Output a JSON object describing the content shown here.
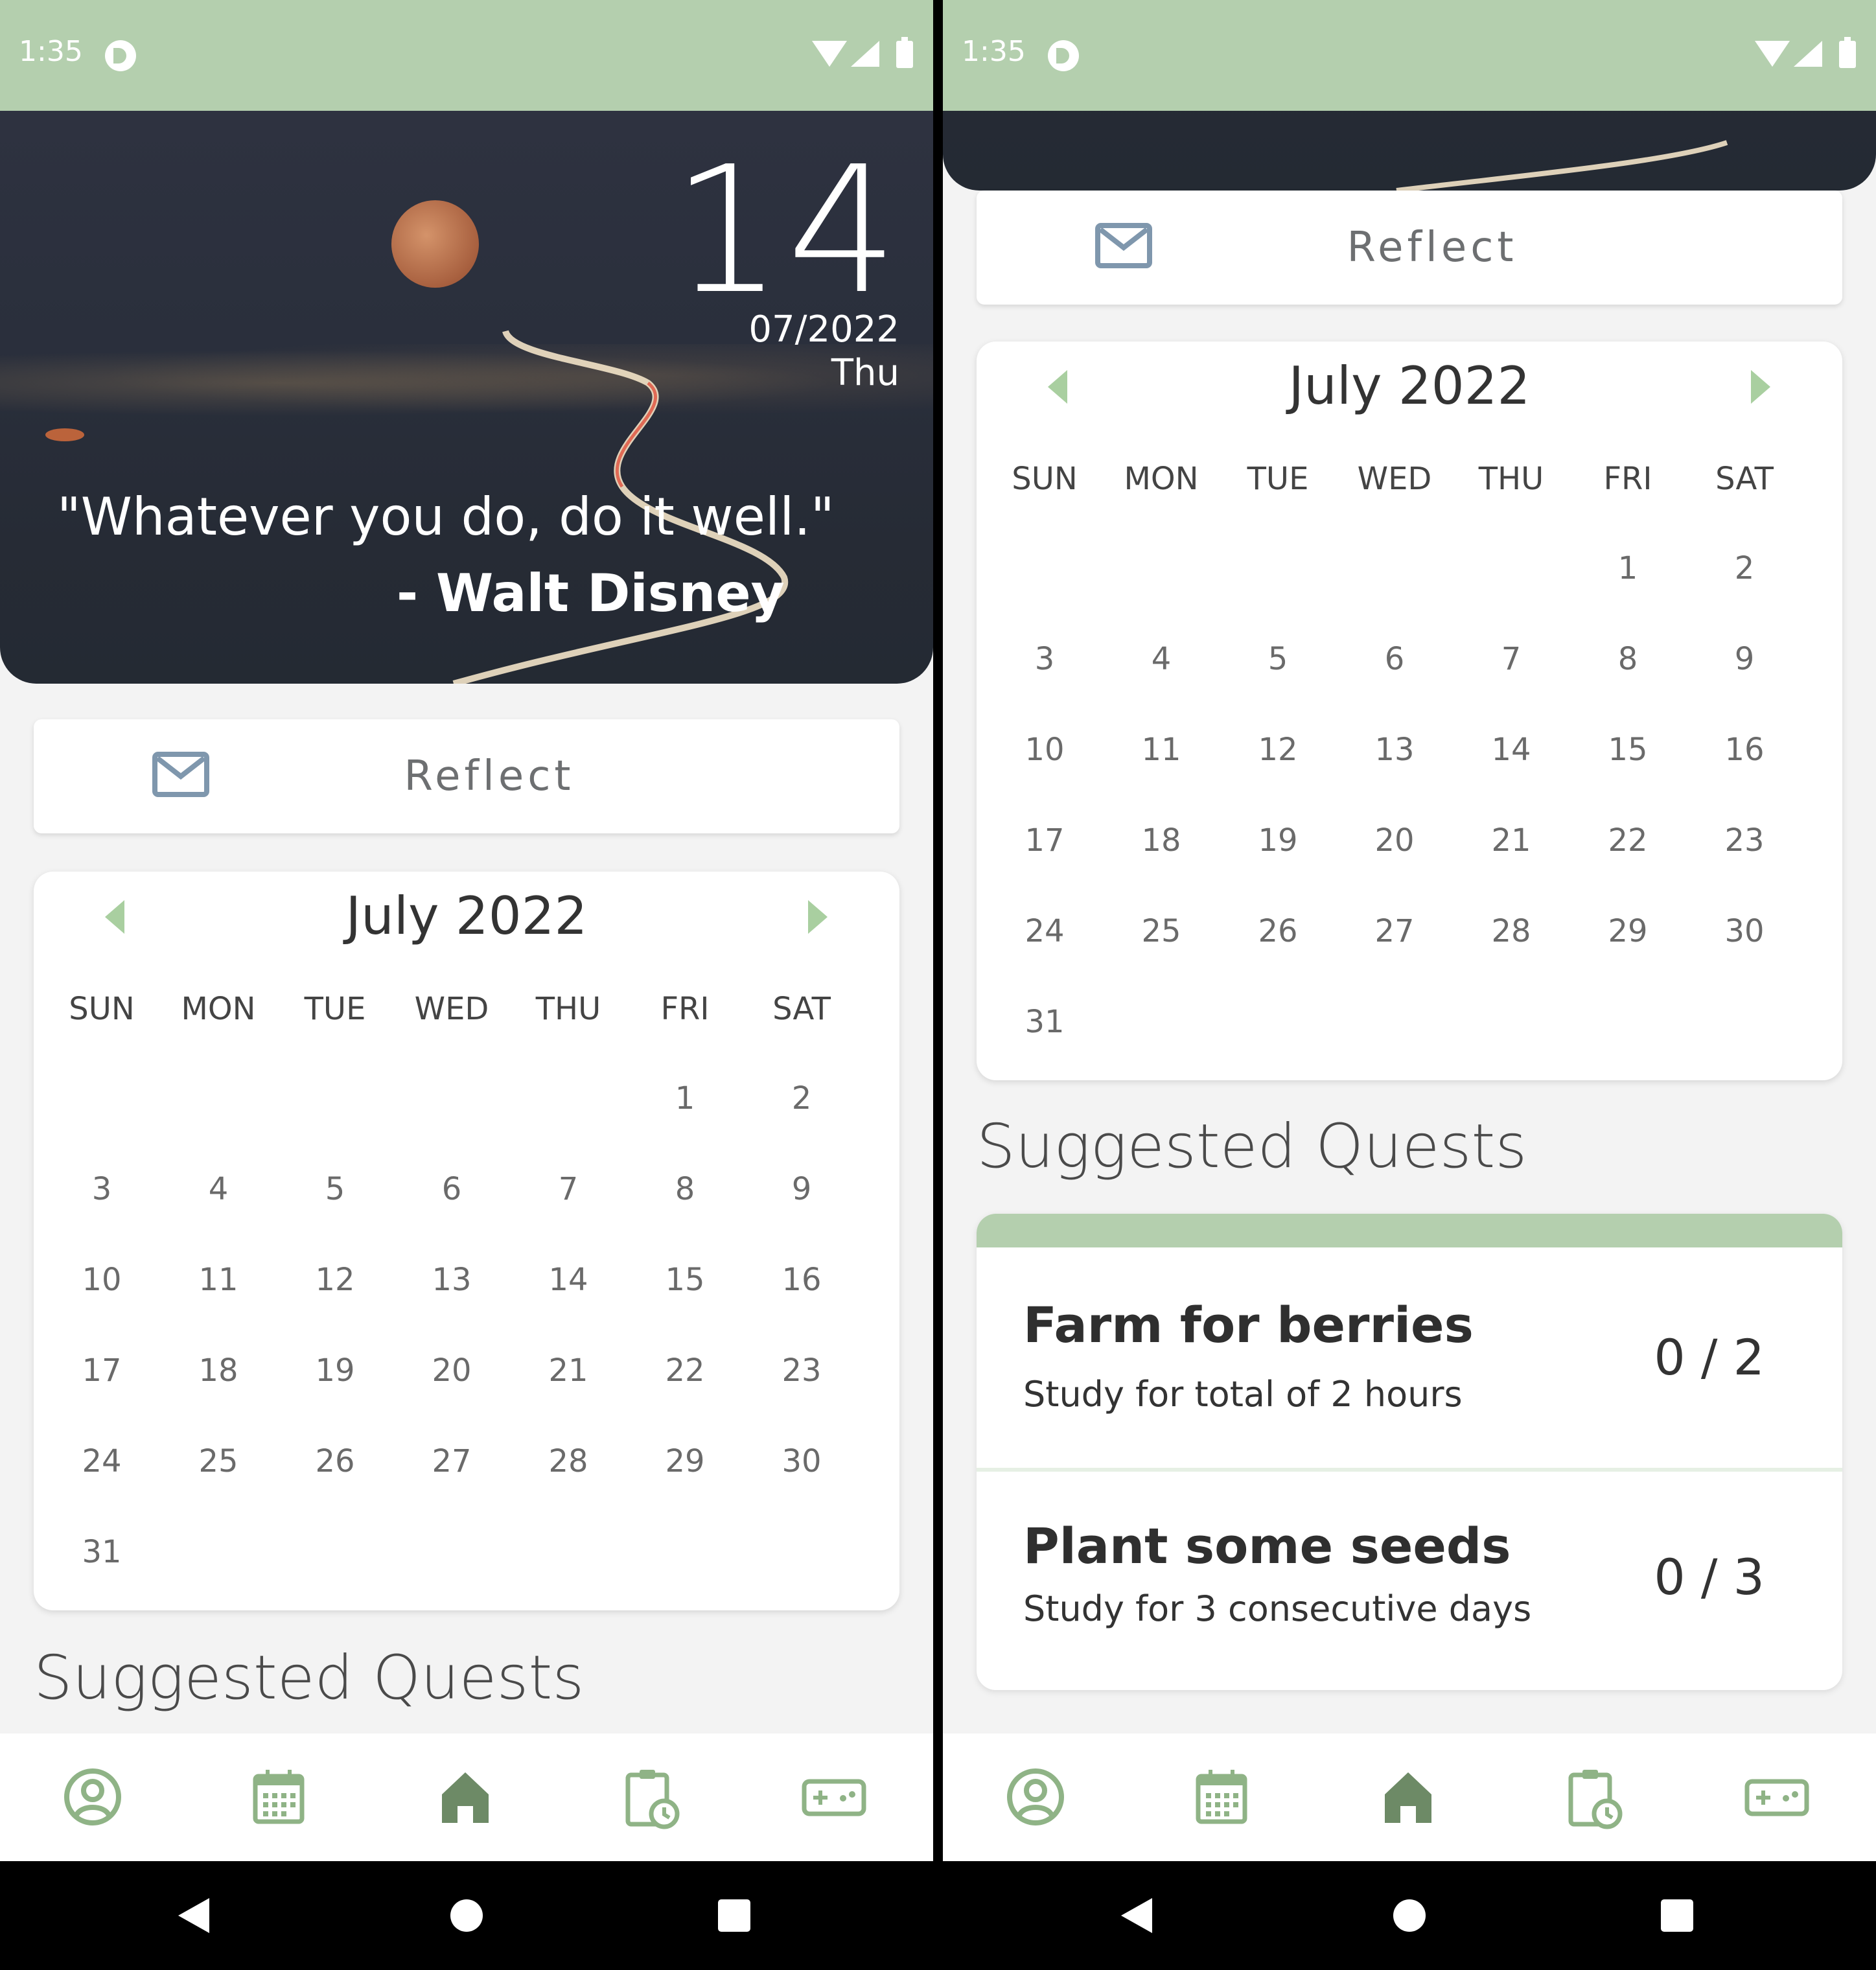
{
  "status_bar": {
    "time": "1:35"
  },
  "hero": {
    "day": "14",
    "month_year": "07/2022",
    "weekday": "Thu",
    "quote": "\"Whatever you do, do it well.\"",
    "author": "- Walt Disney"
  },
  "reflect": {
    "label": "Reflect",
    "icon": "mail-icon"
  },
  "calendar": {
    "title": "July 2022",
    "weekdays": [
      "SUN",
      "MON",
      "TUE",
      "WED",
      "THU",
      "FRI",
      "SAT"
    ],
    "days": [
      "1",
      "2",
      "3",
      "4",
      "5",
      "6",
      "7",
      "8",
      "9",
      "10",
      "11",
      "12",
      "13",
      "14",
      "15",
      "16",
      "17",
      "18",
      "19",
      "20",
      "21",
      "22",
      "23",
      "24",
      "25",
      "26",
      "27",
      "28",
      "29",
      "30",
      "31"
    ]
  },
  "quests": {
    "title": "Suggested Quests",
    "items": [
      {
        "title": "Farm for berries",
        "description": "Study for total of 2 hours",
        "progress": "0 / 2"
      },
      {
        "title": "Plant some seeds",
        "description": "Study for 3 consecutive days",
        "progress": "0 / 3"
      }
    ]
  },
  "bottom_nav": {
    "items": [
      {
        "icon": "profile-icon"
      },
      {
        "icon": "calendar-icon"
      },
      {
        "icon": "home-icon"
      },
      {
        "icon": "schedule-icon"
      },
      {
        "icon": "game-controller-icon"
      }
    ]
  },
  "colors": {
    "accent": "#b4cfae",
    "nav_icon": "#8fb386",
    "nav_active": "#6d8a66",
    "text_muted": "#6d6f71"
  }
}
